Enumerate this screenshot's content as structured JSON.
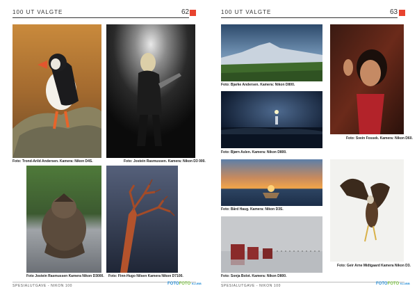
{
  "left": {
    "header": "100 UT VALGTE",
    "page_number": "62",
    "captions": {
      "puffin": "Foto: Trond-Arild Andersen. Kamera: Nikon D4S.",
      "concert": "Foto: Jostein Rasmussen. Kamera: Nikon D3 000.",
      "owl": "Foto Jostein Rasmussen Kamera Nikon D3000.",
      "tree": "Foto: Finn-Hugo Nilsen Kamera Nikon D7100."
    },
    "footer": "SPESIALUTGAVE - NIKON 100",
    "logo": {
      "a": "FOTO",
      "b": "FOTO",
      "c": "KLUBB"
    }
  },
  "right": {
    "header": "100 UT VALGTE",
    "page_number": "63",
    "captions": {
      "mountain": "Foto: Bjarke Andersen. Kamera: Nikon D800.",
      "lighthouse": "Foto: Bjørn Aslen. Kamera: Nikon D800.",
      "sunset": "Foto: Bård Haug. Kamera: Nikon D3S.",
      "houses": "Foto: Sonja Bolot. Kamera: Nikon D800.",
      "girl": "Foto: Svein Fossek. Kamera: Nikon D60.",
      "eagle": "Foto: Geir Arne Midtgaard Kamera Nikon D3."
    },
    "footer": "SPESIALUTGAVE - NIKON 100",
    "logo": {
      "a": "FOTO",
      "b": "FOTO",
      "c": "KLUBB"
    }
  }
}
